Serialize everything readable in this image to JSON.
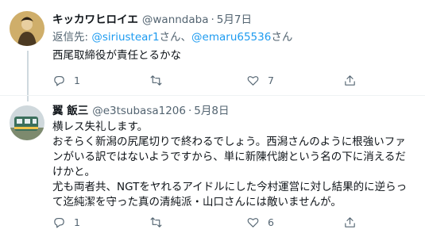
{
  "tweets": [
    {
      "name": "キッカワヒロイエ",
      "handle": "@wanndaba",
      "date": "5月7日",
      "reply_label": "返信先:",
      "reply_mentions": [
        "@siriustear1",
        "@emaru65536"
      ],
      "reply_suffix": "さん",
      "reply_joiner": "さん、",
      "lines": [
        "西尾取締役が責任とるかな"
      ],
      "reply_count": "1",
      "retweet_count": "",
      "like_count": "7"
    },
    {
      "name": "翼 飯三",
      "handle": "@e3tsubasa1206",
      "date": "5月8日",
      "lines": [
        "横レス失礼します。",
        "おそらく新潟の尻尾切りで終わるでしょう。西潟さんのように根強いファ",
        "ンがいる訳ではないようですから、単に新陳代謝という名の下に消えるだ",
        "けかと。",
        "尤も両者共、NGTをヤれるアイドルにした今村運営に対し結果的に逆らっ",
        "て迄純潔を守った真の清純派・山口さんには敵いませんが。"
      ],
      "reply_count": "1",
      "retweet_count": "",
      "like_count": "6"
    }
  ],
  "separator": "·",
  "colors": {
    "link": "#1d9bf0",
    "muted": "#536471",
    "text": "#0f1419",
    "line": "#cfd9de"
  },
  "icons": [
    "reply-icon",
    "retweet-icon",
    "like-icon",
    "share-icon"
  ]
}
